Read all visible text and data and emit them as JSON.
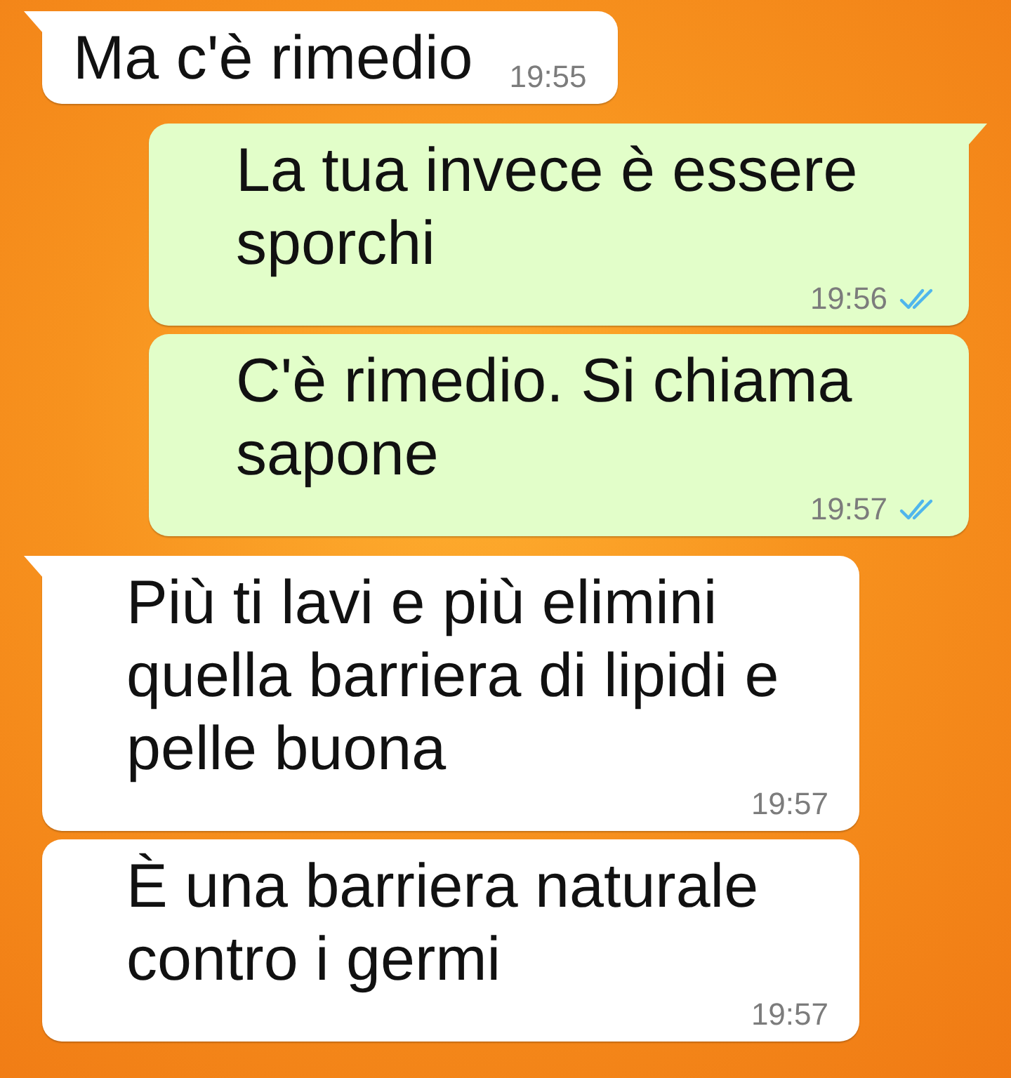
{
  "messages": [
    {
      "outgoing": false,
      "tail": true,
      "text": "Ma c'è rimedio",
      "time": "19:55"
    },
    {
      "outgoing": true,
      "tail": true,
      "text": "La tua invece è essere sporchi",
      "time": "19:56",
      "read": true
    },
    {
      "outgoing": true,
      "tail": false,
      "text": "C'è rimedio. Si chiama sapone",
      "time": "19:57",
      "read": true
    },
    {
      "outgoing": false,
      "tail": true,
      "text": "Più ti lavi e più elimini quella barriera di lipidi e pelle buona",
      "time": "19:57"
    },
    {
      "outgoing": false,
      "tail": false,
      "text": "È una barriera naturale contro i germi",
      "time": "19:57"
    }
  ]
}
